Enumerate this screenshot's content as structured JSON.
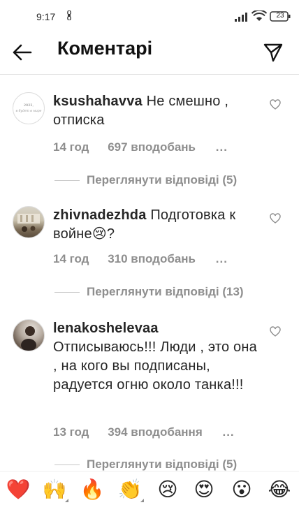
{
  "status_bar": {
    "time": "9:17",
    "battery": "23"
  },
  "header": {
    "title": "Коментарі"
  },
  "comments": [
    {
      "username": "ksushahavva",
      "text": "Не смешно , отписка",
      "time": "14 год",
      "likes": "697 вподобань",
      "more": "...",
      "replies_label": "Переглянути відповіді (5)",
      "avatar_text": "2022, в будет в мире"
    },
    {
      "username": "zhivnadezhda",
      "text": "Подготовка к войне😢?",
      "time": "14 год",
      "likes": "310 вподобань",
      "more": "...",
      "replies_label": "Переглянути відповіді (13)"
    },
    {
      "username": "lenakoshelevaa",
      "text": "Отписываюсь!!! Люди , это она , на кого вы подписаны, радуется огню около танка!!!",
      "time": "13 год",
      "likes": "394 вподобання",
      "more": "...",
      "replies_label": "Переглянути відповіді (5)"
    }
  ],
  "emoji_bar": {
    "items": [
      "❤️",
      "🙌",
      "🔥",
      "👏",
      "😢",
      "😍",
      "😮",
      "😂"
    ]
  },
  "colors": {
    "text": "#262626",
    "secondary": "#8e8e8e",
    "divider": "#e3e3e3",
    "background": "#ffffff"
  }
}
